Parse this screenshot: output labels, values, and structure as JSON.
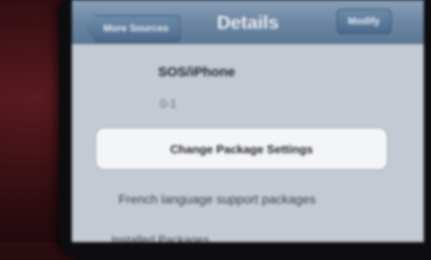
{
  "navbar": {
    "back_label": "More Sources",
    "title": "Details",
    "modify_label": "Modify"
  },
  "package": {
    "name": "SOS/iPhone",
    "version": "0-1"
  },
  "actions": {
    "change_settings_label": "Change Package Settings"
  },
  "sections": {
    "description": "French language support packages",
    "next_header": "Installed Packages"
  }
}
